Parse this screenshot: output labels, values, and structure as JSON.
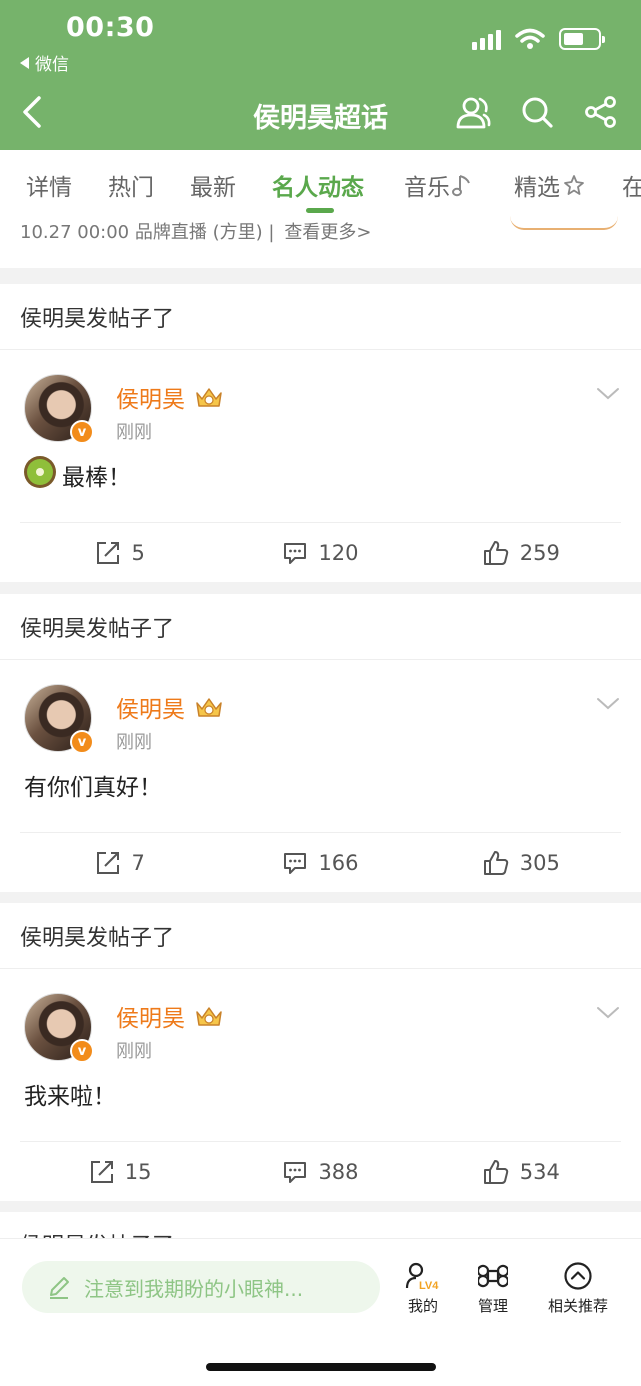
{
  "status_bar": {
    "time": "00:30",
    "back_app": "微信"
  },
  "nav": {
    "title": "侯明昊超话"
  },
  "tabs": [
    {
      "label": "详情"
    },
    {
      "label": "热门"
    },
    {
      "label": "最新"
    },
    {
      "label": "名人动态"
    },
    {
      "label": "音乐"
    },
    {
      "label": "精选"
    },
    {
      "label": "在"
    }
  ],
  "live": {
    "info": "10.27 00:00 品牌直播 (方里) |",
    "more": "查看更多>"
  },
  "posts": [
    {
      "header": "侯明昊发帖子了",
      "author": "侯明昊",
      "time": "刚刚",
      "text": "最棒！",
      "reposts": "5",
      "comments": "120",
      "likes": "259"
    },
    {
      "header": "侯明昊发帖子了",
      "author": "侯明昊",
      "time": "刚刚",
      "text": "有你们真好！",
      "reposts": "7",
      "comments": "166",
      "likes": "305"
    },
    {
      "header": "侯明昊发帖子了",
      "author": "侯明昊",
      "time": "刚刚",
      "text": "我来啦！",
      "reposts": "15",
      "comments": "388",
      "likes": "534"
    }
  ],
  "peek_header": "侯明昊发帖子了",
  "bottom_bar": {
    "comment_placeholder": "注意到我期盼的小眼神...",
    "mine": "我的",
    "manage": "管理",
    "related": "相关推荐",
    "level_badge": "LV4"
  },
  "colors": {
    "header_bg": "#76b36b",
    "accent_green": "#5aa84c",
    "author_orange": "#ee7a1a"
  }
}
